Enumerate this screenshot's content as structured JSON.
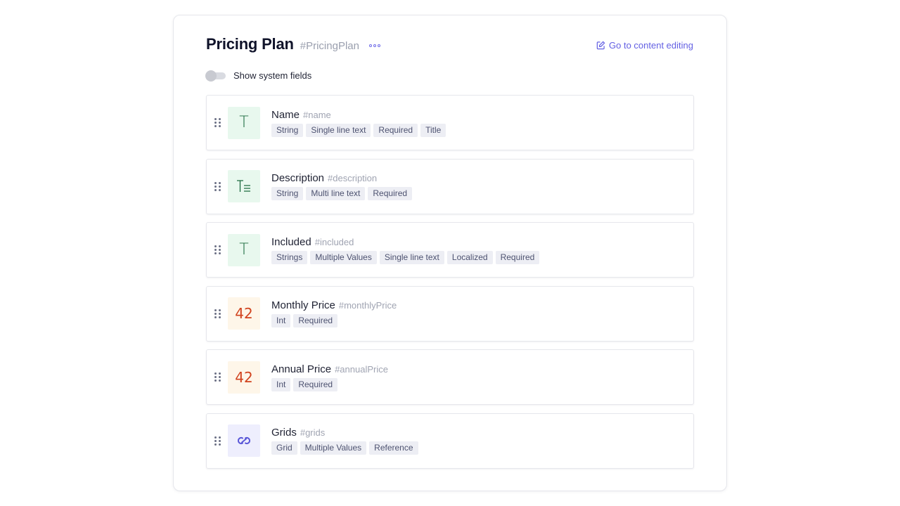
{
  "header": {
    "title": "Pricing Plan",
    "api_id": "#PricingPlan",
    "edit_link": "Go to content editing"
  },
  "system_toggle": {
    "label": "Show system fields",
    "enabled": false
  },
  "colors": {
    "accent": "#6360e3",
    "green_icon_bg": "#e8f8ee",
    "orange_icon_bg": "#fef6e9",
    "purple_icon_bg": "#eeeefd",
    "tag_bg": "#edeef4"
  },
  "fields": [
    {
      "name": "Name",
      "api_id": "#name",
      "icon": "single-line-text-icon",
      "glyph": "T",
      "tags": [
        "String",
        "Single line text",
        "Required",
        "Title"
      ]
    },
    {
      "name": "Description",
      "api_id": "#description",
      "icon": "multi-line-text-icon",
      "glyph": "T",
      "tags": [
        "String",
        "Multi line text",
        "Required"
      ]
    },
    {
      "name": "Included",
      "api_id": "#included",
      "icon": "single-line-text-icon",
      "glyph": "T",
      "tags": [
        "Strings",
        "Multiple Values",
        "Single line text",
        "Localized",
        "Required"
      ]
    },
    {
      "name": "Monthly Price",
      "api_id": "#monthlyPrice",
      "icon": "integer-icon",
      "glyph": "42",
      "tags": [
        "Int",
        "Required"
      ]
    },
    {
      "name": "Annual Price",
      "api_id": "#annualPrice",
      "icon": "integer-icon",
      "glyph": "42",
      "tags": [
        "Int",
        "Required"
      ]
    },
    {
      "name": "Grids",
      "api_id": "#grids",
      "icon": "reference-link-icon",
      "glyph": "",
      "tags": [
        "Grid",
        "Multiple Values",
        "Reference"
      ]
    }
  ]
}
